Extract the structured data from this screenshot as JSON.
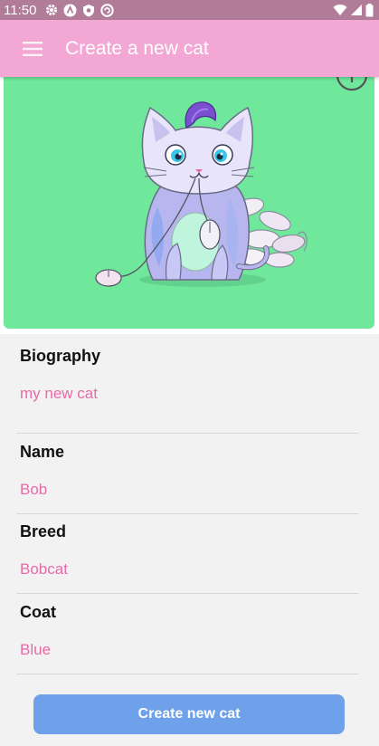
{
  "status_bar": {
    "time": "11:50",
    "icons": [
      "gear-icon",
      "notification-a-icon",
      "shield-icon",
      "sync-icon"
    ],
    "right_icons": [
      "wifi-icon",
      "signal-icon",
      "battery-icon"
    ]
  },
  "app_bar": {
    "title": "Create a new cat",
    "menu_icon": "hamburger-menu-icon",
    "color": "#f3a7d4"
  },
  "hero": {
    "background": "#6fe89c",
    "add_icon": "add-circle-icon"
  },
  "form": {
    "biography": {
      "label": "Biography",
      "value": "my new cat"
    },
    "name": {
      "label": "Name",
      "value": "Bob"
    },
    "breed": {
      "label": "Breed",
      "value": "Bobcat"
    },
    "coat": {
      "label": "Coat",
      "value": "Blue"
    }
  },
  "actions": {
    "create_label": "Create new cat",
    "create_color": "#6fa0ea"
  },
  "colors": {
    "value_text": "#e86aa8",
    "status_bar": "#b07c98"
  }
}
